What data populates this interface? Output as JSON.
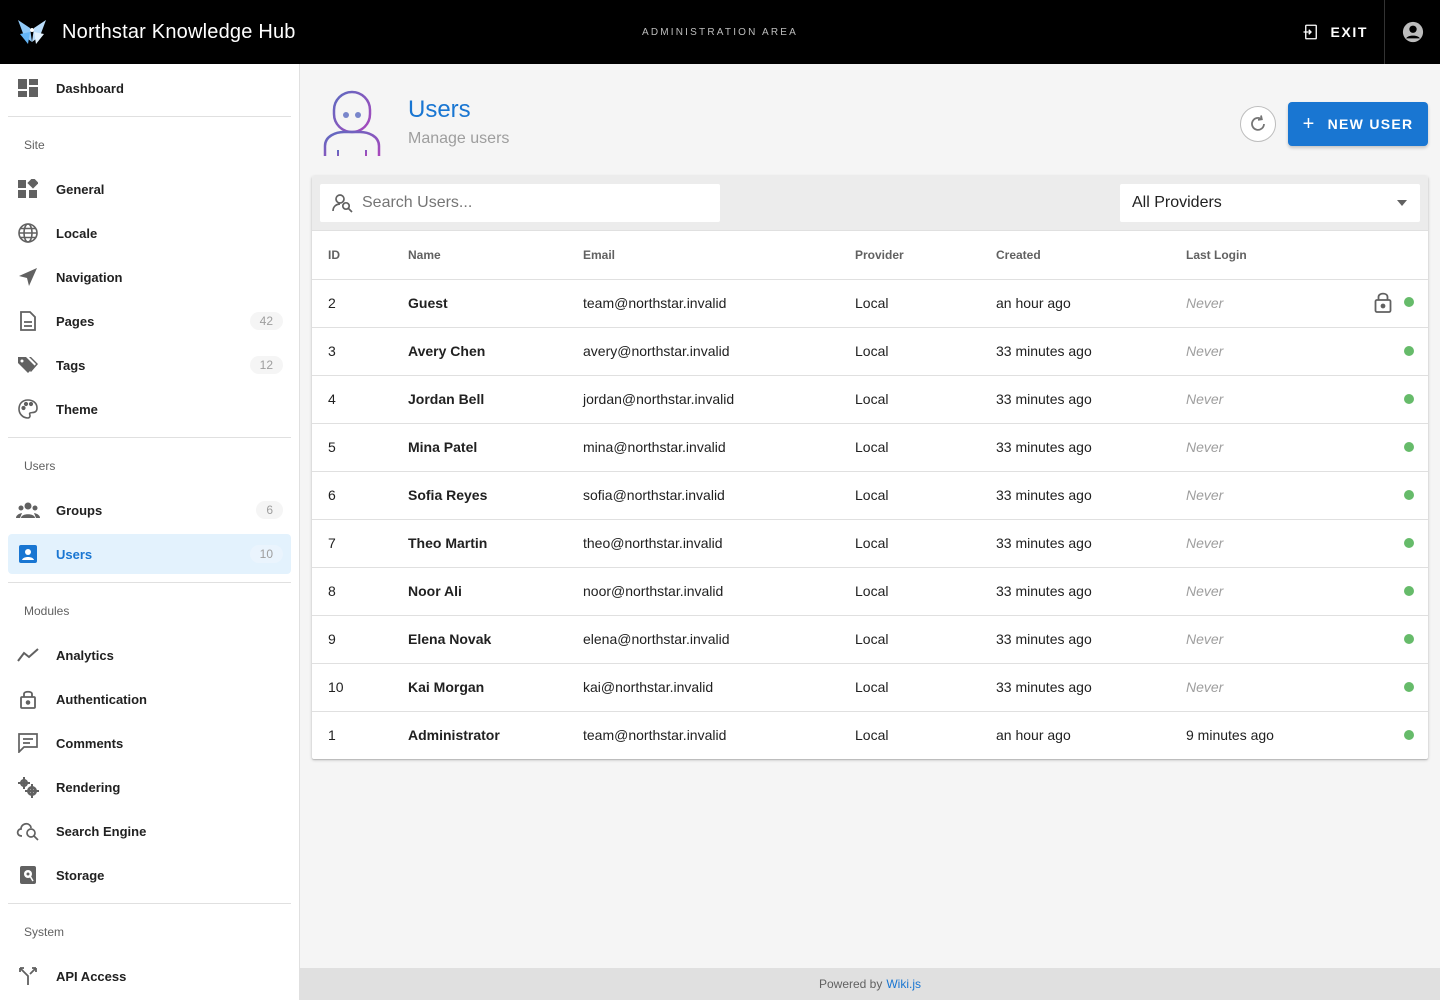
{
  "app": {
    "title": "Northstar Knowledge Hub",
    "area_label": "ADMINISTRATION AREA",
    "exit_label": "EXIT"
  },
  "sidebar": {
    "items": [
      {
        "label": "Dashboard",
        "icon": "dashboard-icon"
      },
      {
        "section": "Site"
      },
      {
        "label": "General",
        "icon": "widgets-icon"
      },
      {
        "label": "Locale",
        "icon": "globe-icon"
      },
      {
        "label": "Navigation",
        "icon": "navigation-arrow-icon"
      },
      {
        "label": "Pages",
        "icon": "page-icon",
        "count": "42"
      },
      {
        "label": "Tags",
        "icon": "tags-icon",
        "count": "12"
      },
      {
        "label": "Theme",
        "icon": "palette-icon"
      },
      {
        "section": "Users"
      },
      {
        "label": "Groups",
        "icon": "groups-icon",
        "count": "6"
      },
      {
        "label": "Users",
        "icon": "user-card-icon",
        "count": "10",
        "active": true
      },
      {
        "section": "Modules"
      },
      {
        "label": "Analytics",
        "icon": "analytics-icon"
      },
      {
        "label": "Authentication",
        "icon": "lock-icon"
      },
      {
        "label": "Comments",
        "icon": "comments-icon"
      },
      {
        "label": "Rendering",
        "icon": "rendering-gears-icon"
      },
      {
        "label": "Search Engine",
        "icon": "cloud-search-icon"
      },
      {
        "label": "Storage",
        "icon": "storage-icon"
      },
      {
        "section": "System"
      },
      {
        "label": "API Access",
        "icon": "api-icon"
      }
    ]
  },
  "header": {
    "title": "Users",
    "subtitle": "Manage users",
    "new_user_label": "NEW USER"
  },
  "toolbar": {
    "search_placeholder": "Search Users...",
    "provider_value": "All Providers"
  },
  "table": {
    "headers": {
      "id": "ID",
      "name": "Name",
      "email": "Email",
      "provider": "Provider",
      "created": "Created",
      "last_login": "Last Login"
    },
    "rows": [
      {
        "id": "2",
        "name": "Guest",
        "email": "team@northstar.invalid",
        "provider": "Local",
        "created": "an hour ago",
        "last_login": "Never",
        "locked": true
      },
      {
        "id": "3",
        "name": "Avery Chen",
        "email": "avery@northstar.invalid",
        "provider": "Local",
        "created": "33 minutes ago",
        "last_login": "Never"
      },
      {
        "id": "4",
        "name": "Jordan Bell",
        "email": "jordan@northstar.invalid",
        "provider": "Local",
        "created": "33 minutes ago",
        "last_login": "Never"
      },
      {
        "id": "5",
        "name": "Mina Patel",
        "email": "mina@northstar.invalid",
        "provider": "Local",
        "created": "33 minutes ago",
        "last_login": "Never"
      },
      {
        "id": "6",
        "name": "Sofia Reyes",
        "email": "sofia@northstar.invalid",
        "provider": "Local",
        "created": "33 minutes ago",
        "last_login": "Never"
      },
      {
        "id": "7",
        "name": "Theo Martin",
        "email": "theo@northstar.invalid",
        "provider": "Local",
        "created": "33 minutes ago",
        "last_login": "Never"
      },
      {
        "id": "8",
        "name": "Noor Ali",
        "email": "noor@northstar.invalid",
        "provider": "Local",
        "created": "33 minutes ago",
        "last_login": "Never"
      },
      {
        "id": "9",
        "name": "Elena Novak",
        "email": "elena@northstar.invalid",
        "provider": "Local",
        "created": "33 minutes ago",
        "last_login": "Never"
      },
      {
        "id": "10",
        "name": "Kai Morgan",
        "email": "kai@northstar.invalid",
        "provider": "Local",
        "created": "33 minutes ago",
        "last_login": "Never"
      },
      {
        "id": "1",
        "name": "Administrator",
        "email": "team@northstar.invalid",
        "provider": "Local",
        "created": "an hour ago",
        "last_login": "9 minutes ago"
      }
    ]
  },
  "footer": {
    "prefix": "Powered by",
    "link": "Wiki.js"
  },
  "colors": {
    "accent": "#1976d2",
    "active_bg": "#e3f2fd",
    "status_active": "#66bb6a",
    "topbar": "#000000"
  }
}
